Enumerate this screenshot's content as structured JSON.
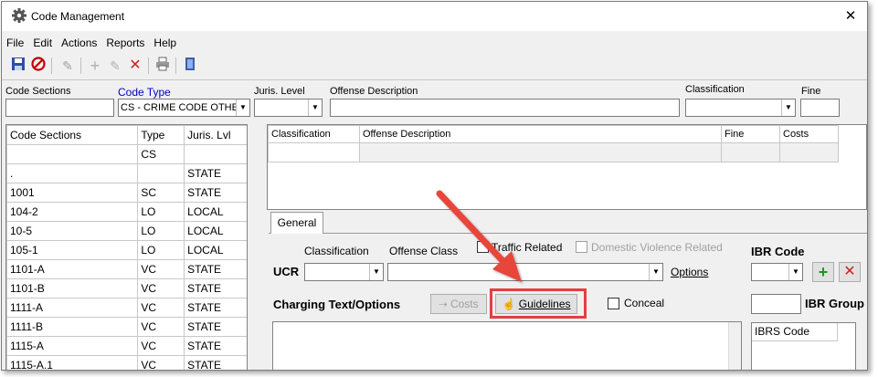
{
  "window": {
    "title": "Code Management"
  },
  "menu": [
    "File",
    "Edit",
    "Actions",
    "Reports",
    "Help"
  ],
  "filters": {
    "code_sections_label": "Code Sections",
    "code_type_label": "Code Type",
    "code_type_value": "CS - CRIME CODE OTHER",
    "juris_level_label": "Juris. Level",
    "offense_description_label": "Offense Description",
    "classification_label": "Classification",
    "fine_label": "Fine"
  },
  "left_table": {
    "headers": [
      "Code Sections",
      "Type",
      "Juris. Lvl"
    ],
    "rows": [
      [
        "",
        "CS",
        ""
      ],
      [
        ".",
        "",
        "STATE"
      ],
      [
        "1001",
        "SC",
        "STATE"
      ],
      [
        "104-2",
        "LO",
        "LOCAL"
      ],
      [
        "10-5",
        "LO",
        "LOCAL"
      ],
      [
        "105-1",
        "LO",
        "LOCAL"
      ],
      [
        "1101-A",
        "VC",
        "STATE"
      ],
      [
        "1101-B",
        "VC",
        "STATE"
      ],
      [
        "1111-A",
        "VC",
        "STATE"
      ],
      [
        "1111-B",
        "VC",
        "STATE"
      ],
      [
        "1115-A",
        "VC",
        "STATE"
      ],
      [
        "1115-A.1",
        "VC",
        "STATE"
      ]
    ]
  },
  "right_grid": {
    "headers": [
      "Classification",
      "Offense Description",
      "Fine",
      "Costs"
    ]
  },
  "general": {
    "tab_label": "General",
    "classification_label": "Classification",
    "offense_class_label": "Offense Class",
    "traffic_related_label": "Traffic Related",
    "domestic_violence_label": "Domestic Violence Related",
    "ucr_label": "UCR",
    "options_link": "Options",
    "ibr_code_label": "IBR Code",
    "charging_text_label": "Charging Text/Options",
    "costs_button": "Costs",
    "guidelines_button": "Guidelines",
    "conceal_label": "Conceal",
    "ibr_group_label": "IBR Group",
    "ibrs_code_header": "IBRS Code"
  },
  "colors": {
    "highlight": "#e04040",
    "arrow": "#e8443a",
    "link": "#0000cc"
  }
}
